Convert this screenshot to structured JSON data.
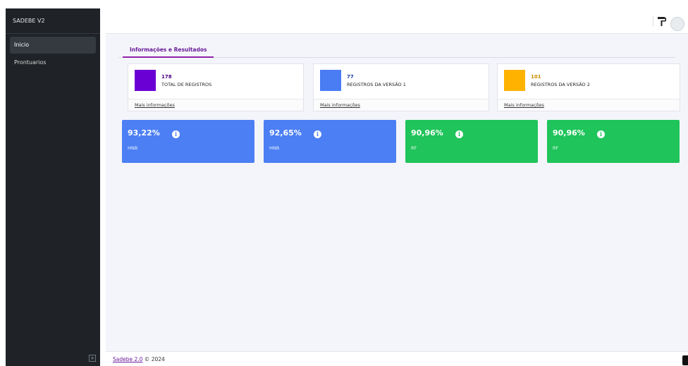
{
  "app": {
    "brand": "SADEBE V2"
  },
  "sidebar": {
    "items": [
      {
        "label": "Inicio",
        "active": true
      },
      {
        "label": "Prontuarios",
        "active": false
      }
    ],
    "collapse_icon": "expand-icon"
  },
  "topbar": {
    "icons": [
      "paint-roller-icon",
      "user-avatar"
    ]
  },
  "tabs": [
    {
      "label": "Informações e Resultados",
      "active": true
    }
  ],
  "info_cards": [
    {
      "count": "178",
      "label": "TOTAL DE REGISTROS",
      "more": "Mais informações",
      "color": "#6a00d4",
      "count_color": "#4b0082"
    },
    {
      "count": "77",
      "label": "REGISTROS DA VERSÃO 1",
      "more": "Mais informações",
      "color": "#4a7cf3",
      "count_color": "#1d3fa8"
    },
    {
      "count": "101",
      "label": "REGISTROS DA VERSÃO 2",
      "more": "Mais informações",
      "color": "#ffb300",
      "count_color": "#c98d00"
    }
  ],
  "stat_cards": [
    {
      "value": "93,22%",
      "sublabel": "HNB",
      "color": "#4c7ff4",
      "icon": "info-icon"
    },
    {
      "value": "92,65%",
      "sublabel": "HNB",
      "color": "#4c7ff4",
      "icon": "info-icon"
    },
    {
      "value": "90,96%",
      "sublabel": "RF",
      "color": "#1fc45a",
      "icon": "info-icon"
    },
    {
      "value": "90,96%",
      "sublabel": "RF",
      "color": "#1fc45a",
      "icon": "info-icon"
    }
  ],
  "footer": {
    "link": "Sadebe 2.0",
    "text": " © 2024"
  }
}
